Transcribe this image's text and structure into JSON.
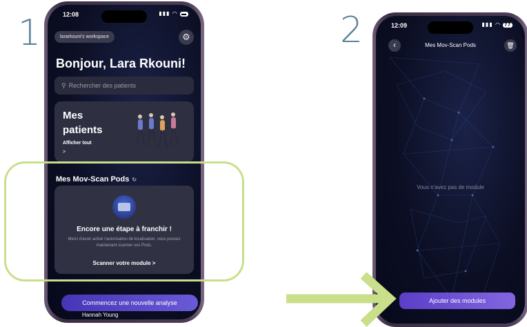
{
  "steps": {
    "one": "1",
    "two": "2"
  },
  "colors": {
    "highlight": "#c9df8a",
    "step_text": "#5b7f98",
    "accent": "#5a3fc8"
  },
  "screen1": {
    "status_time": "12:08",
    "workspace_label": "lararkouni's workspace",
    "settings_icon": "gear-icon",
    "greeting": "Bonjour, Lara Rkouni!",
    "search_placeholder": "Rechercher des patients",
    "patients_card": {
      "title": "Mes patients",
      "link": "Afficher tout",
      "arrow": ">"
    },
    "pods_title": "Mes Mov-Scan Pods",
    "pods_ref_icon": "refresh-icon",
    "pods_card": {
      "heading": "Encore une étape à franchir !",
      "description": "Merci d'avoir activé l'autorisation de localisation, vous pouvez maintenant scanner vos Pods.",
      "cta": "Scanner votre module >"
    },
    "start_button": "Commencez une nouvelle analyse",
    "patient_name": "Hannah Young"
  },
  "screen2": {
    "status_time": "12:09",
    "battery": "77",
    "title": "Mes Mov-Scan Pods",
    "empty_message": "Vous n'avez pas de module",
    "add_button": "Ajouter des modules"
  }
}
